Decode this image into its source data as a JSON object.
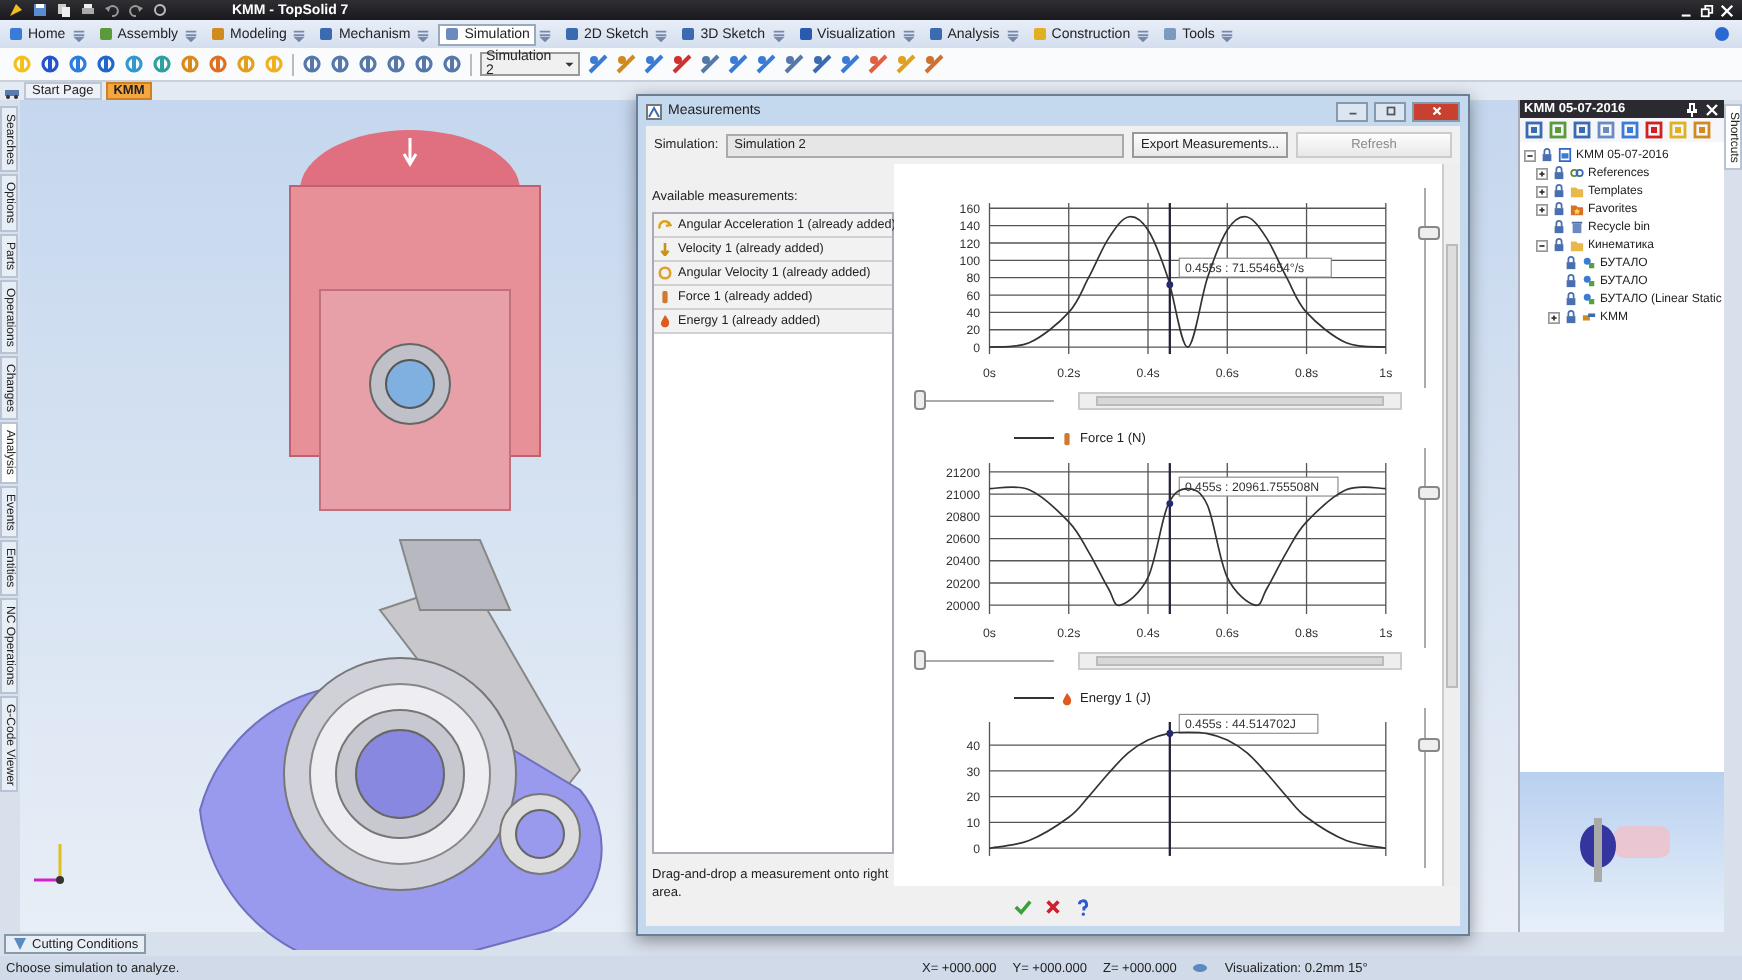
{
  "window": {
    "title": "KMM - TopSolid 7"
  },
  "ribbon_tabs": [
    {
      "label": "Home",
      "selected": false
    },
    {
      "label": "Assembly",
      "selected": false
    },
    {
      "label": "Modeling",
      "selected": false
    },
    {
      "label": "Mechanism",
      "selected": false
    },
    {
      "label": "Simulation",
      "selected": true
    },
    {
      "label": "2D Sketch",
      "selected": false
    },
    {
      "label": "3D Sketch",
      "selected": false
    },
    {
      "label": "Visualization",
      "selected": false
    },
    {
      "label": "Analysis",
      "selected": false
    },
    {
      "label": "Construction",
      "selected": false
    },
    {
      "label": "Tools",
      "selected": false
    }
  ],
  "toolbar": {
    "simulation_select": "Simulation 2"
  },
  "document_tabs": [
    {
      "label": "Start Page",
      "selected": false
    },
    {
      "label": "KMM",
      "selected": true
    }
  ],
  "side_tabs": [
    {
      "label": "Searches",
      "selected": false
    },
    {
      "label": "Options",
      "selected": false
    },
    {
      "label": "Parts",
      "selected": false
    },
    {
      "label": "Operations",
      "selected": false
    },
    {
      "label": "Changes",
      "selected": false
    },
    {
      "label": "Analysis",
      "selected": true
    },
    {
      "label": "Events",
      "selected": false
    },
    {
      "label": "Entities",
      "selected": false
    },
    {
      "label": "NC Operations",
      "selected": false
    },
    {
      "label": "G-Code Viewer",
      "selected": false
    }
  ],
  "measurements_dialog": {
    "title": "Measurements",
    "simulation_label": "Simulation:",
    "simulation_value": "Simulation 2",
    "export_button": "Export Measurements...",
    "refresh_button": {
      "label": "Refresh",
      "disabled": true
    },
    "available_label": "Available measurements:",
    "measurements": [
      {
        "label": "Angular Acceleration 1 (already added)",
        "kind": "acceleration"
      },
      {
        "label": "Velocity 1 (already added)",
        "kind": "velocity"
      },
      {
        "label": "Angular Velocity 1 (already added)",
        "kind": "spin"
      },
      {
        "label": "Force 1 (already added)",
        "kind": "force"
      },
      {
        "label": "Energy 1 (already added)",
        "kind": "energy"
      }
    ],
    "hint": "Drag-and-drop a measurement onto right area.",
    "charts": [
      {
        "v_zoom": {
          "level": 0.8
        },
        "h_zoom": {
          "level": 0
        },
        "chart_data": {
          "type": "line",
          "x": [
            0,
            0.1,
            0.2,
            0.25,
            0.3,
            0.35,
            0.4,
            0.45,
            0.5,
            0.55,
            0.6,
            0.65,
            0.7,
            0.75,
            0.8,
            0.9,
            1
          ],
          "series": [
            {
              "color": "#333333",
              "values": [
                0,
                5,
                40,
                80,
                125,
                150,
                135,
                80,
                0,
                80,
                135,
                150,
                125,
                80,
                40,
                5,
                0
              ]
            }
          ],
          "xlim": [
            0,
            1
          ],
          "ylim": [
            -8,
            166
          ],
          "xticks": [
            {
              "value": 0,
              "label": "0s"
            },
            {
              "value": 0.2,
              "label": "0.2s"
            },
            {
              "value": 0.4,
              "label": "0.4s"
            },
            {
              "value": 0.6,
              "label": "0.6s"
            },
            {
              "value": 0.8,
              "label": "0.8s"
            },
            {
              "value": 1,
              "label": "1s"
            }
          ],
          "yticks": [
            0,
            20,
            40,
            60,
            80,
            100,
            120,
            140,
            160
          ],
          "grid": true,
          "ref_lines": [
            {
              "axis": "x",
              "value": 0.455
            }
          ],
          "annotations": [
            "0.455s : 71.554654°/s"
          ]
        }
      },
      {
        "kind": "force",
        "v_zoom": {
          "level": 0.8
        },
        "h_zoom": {
          "level": 0
        },
        "chart_data": {
          "type": "line",
          "x": [
            0,
            0.1,
            0.2,
            0.25,
            0.3,
            0.33,
            0.4,
            0.45,
            0.5,
            0.55,
            0.6,
            0.67,
            0.7,
            0.75,
            0.8,
            0.9,
            1
          ],
          "series": [
            {
              "name": "Force 1 (N)",
              "color": "#333333",
              "values": [
                21050,
                21040,
                20750,
                20480,
                20150,
                20000,
                20250,
                20900,
                21050,
                20900,
                20250,
                20000,
                20150,
                20480,
                20750,
                21040,
                21050
              ]
            }
          ],
          "xlim": [
            0,
            1
          ],
          "ylim": [
            19920,
            21280
          ],
          "xticks": [
            {
              "value": 0,
              "label": "0s"
            },
            {
              "value": 0.2,
              "label": "0.2s"
            },
            {
              "value": 0.4,
              "label": "0.4s"
            },
            {
              "value": 0.6,
              "label": "0.6s"
            },
            {
              "value": 0.8,
              "label": "0.8s"
            },
            {
              "value": 1,
              "label": "1s"
            }
          ],
          "yticks": [
            20000,
            20200,
            20400,
            20600,
            20800,
            21000,
            21200
          ],
          "grid": true,
          "ref_lines": [
            {
              "axis": "x",
              "value": 0.455
            }
          ],
          "annotations": [
            "0.455s : 20961.755508N"
          ]
        }
      },
      {
        "kind": "energy",
        "v_zoom": {
          "level": 0.8
        },
        "chart_data": {
          "type": "line",
          "x": [
            0,
            0.1,
            0.2,
            0.25,
            0.3,
            0.35,
            0.4,
            0.45,
            0.5,
            0.55,
            0.6,
            0.65,
            0.7,
            0.75,
            0.8,
            0.9,
            1
          ],
          "series": [
            {
              "name": "Energy 1 (J)",
              "color": "#333333",
              "values": [
                0,
                3,
                12,
                20,
                29,
                37,
                42,
                44.5,
                45,
                44.5,
                42,
                37,
                29,
                20,
                12,
                3,
                0
              ]
            }
          ],
          "xlim": [
            0,
            1
          ],
          "ylim": [
            -3,
            49
          ],
          "yticks": [
            0,
            10,
            20,
            30,
            40
          ],
          "grid": true,
          "ref_lines": [
            {
              "axis": "x",
              "value": 0.455
            }
          ],
          "annotations": [
            "0.455s : 44.514702J"
          ]
        }
      }
    ]
  },
  "tree": {
    "title": "KMM 05-07-2016",
    "items": [
      {
        "label": "KMM 05-07-2016",
        "kind": "document",
        "expanded": true,
        "children": [
          {
            "label": "References",
            "kind": "links",
            "expanded": false
          },
          {
            "label": "Templates",
            "kind": "folder",
            "expanded": false
          },
          {
            "label": "Favorites",
            "kind": "star",
            "expanded": false
          },
          {
            "label": "Recycle bin",
            "kind": "bin"
          },
          {
            "label": "Кинематика",
            "kind": "folder",
            "expanded": true,
            "children": [
              {
                "label": "БУТАЛО",
                "kind": "part"
              },
              {
                "label": "БУТАЛО",
                "kind": "part"
              },
              {
                "label": "БУТАЛО (Linear Static",
                "kind": "part"
              },
              {
                "label": "KMM",
                "kind": "assembly",
                "expanded": false
              }
            ]
          }
        ]
      }
    ]
  },
  "right_strip": {
    "label": "Shortcuts"
  },
  "bottom_tabs": [
    {
      "label": "Cutting Conditions"
    }
  ],
  "status_bar": {
    "message": "Choose simulation to analyze.",
    "x": "X= +000.000",
    "y": "Y= +000.000",
    "z": "Z= +000.000",
    "visualization": "Visualization: 0.2mm 15°"
  }
}
